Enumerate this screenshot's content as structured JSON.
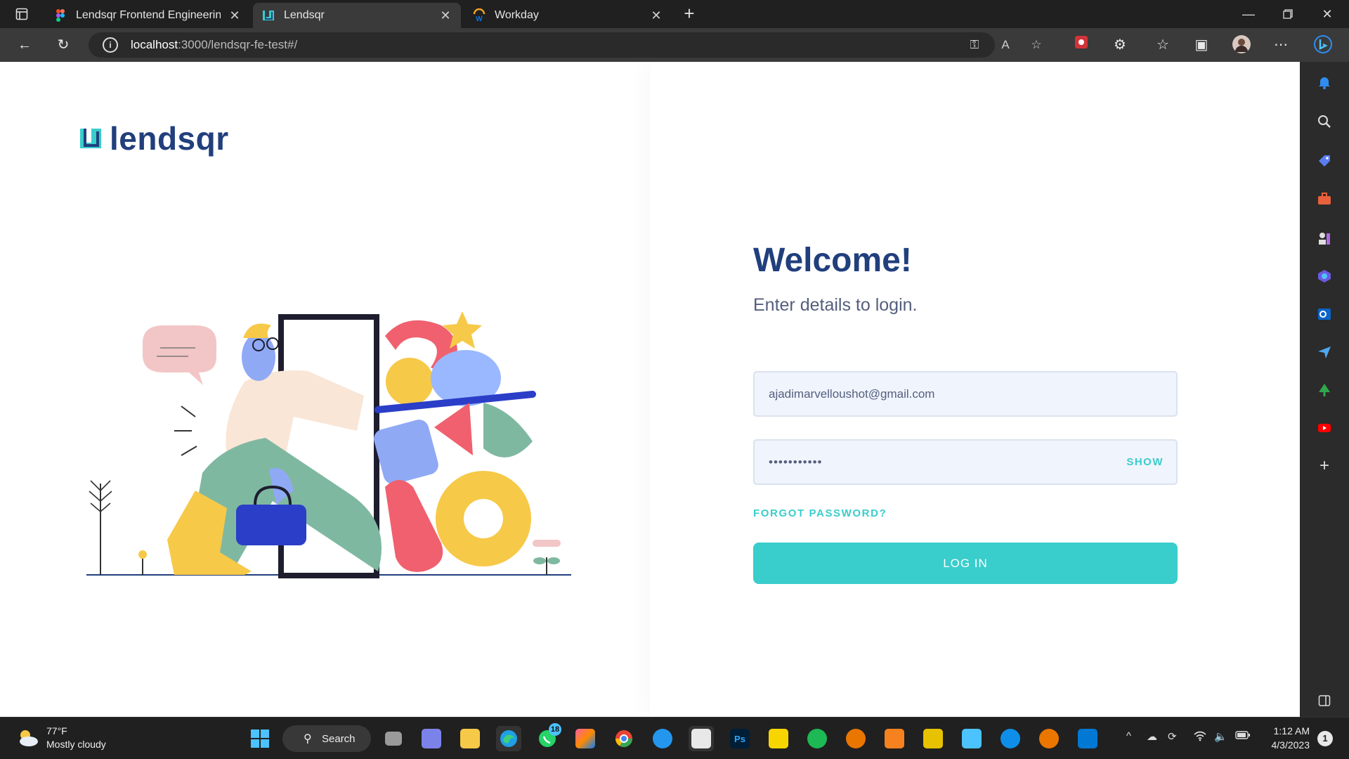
{
  "tabs": [
    {
      "title": "Lendsqr Frontend Engineering As",
      "active": false
    },
    {
      "title": "Lendsqr",
      "active": true
    },
    {
      "title": "Workday",
      "active": false
    }
  ],
  "address": {
    "host": "localhost",
    "path": ":3000/lendsqr-fe-test#/"
  },
  "page": {
    "logo_text": "lendsqr",
    "welcome": "Welcome!",
    "subtitle": "Enter details to login.",
    "email_value": "ajadimarvelloushot@gmail.com",
    "password_value": "•••••••••••",
    "show_label": "SHOW",
    "forgot_label": "FORGOT PASSWORD?",
    "login_label": "LOG IN"
  },
  "taskbar": {
    "weather_temp": "77°F",
    "weather_desc": "Mostly cloudy",
    "search_label": "Search",
    "whatsapp_badge": "18",
    "time": "1:12 AM",
    "date": "4/3/2023",
    "notification_count": "1"
  },
  "colors": {
    "brand": "#213f7d",
    "accent": "#39cdcc",
    "subtext": "#545f7d"
  }
}
